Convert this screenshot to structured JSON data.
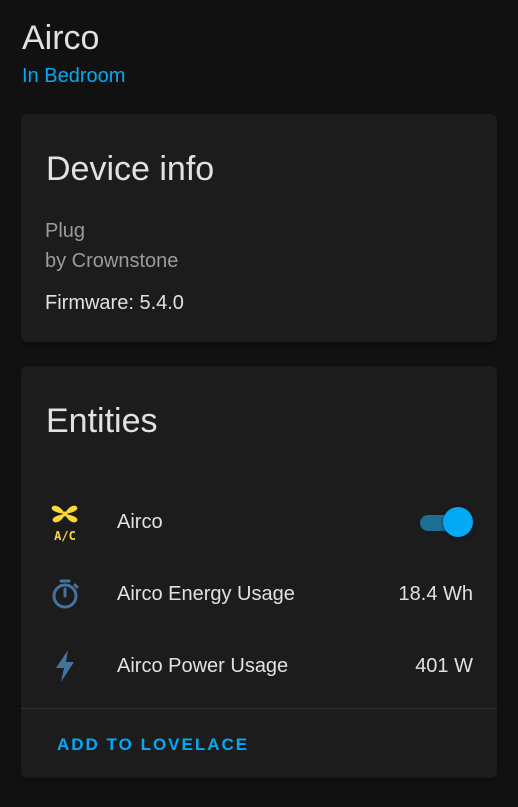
{
  "header": {
    "title": "Airco",
    "area_link": "In Bedroom"
  },
  "device_info": {
    "title": "Device info",
    "model": "Plug",
    "manufacturer": "by Crownstone",
    "firmware": "Firmware: 5.4.0"
  },
  "entities": {
    "title": "Entities",
    "items": [
      {
        "name": "Airco",
        "icon": "air-conditioner-icon",
        "state": "on",
        "icon_color": "#fdd835"
      },
      {
        "name": "Airco Energy Usage",
        "icon": "timer-icon",
        "value": "18.4 Wh",
        "icon_color": "#44739e"
      },
      {
        "name": "Airco Power Usage",
        "icon": "flash-icon",
        "value": "401 W",
        "icon_color": "#44739e"
      }
    ],
    "action_label": "ADD TO LOVELACE"
  },
  "colors": {
    "accent": "#03a9f4",
    "background": "#111111",
    "card": "#1c1c1c"
  }
}
